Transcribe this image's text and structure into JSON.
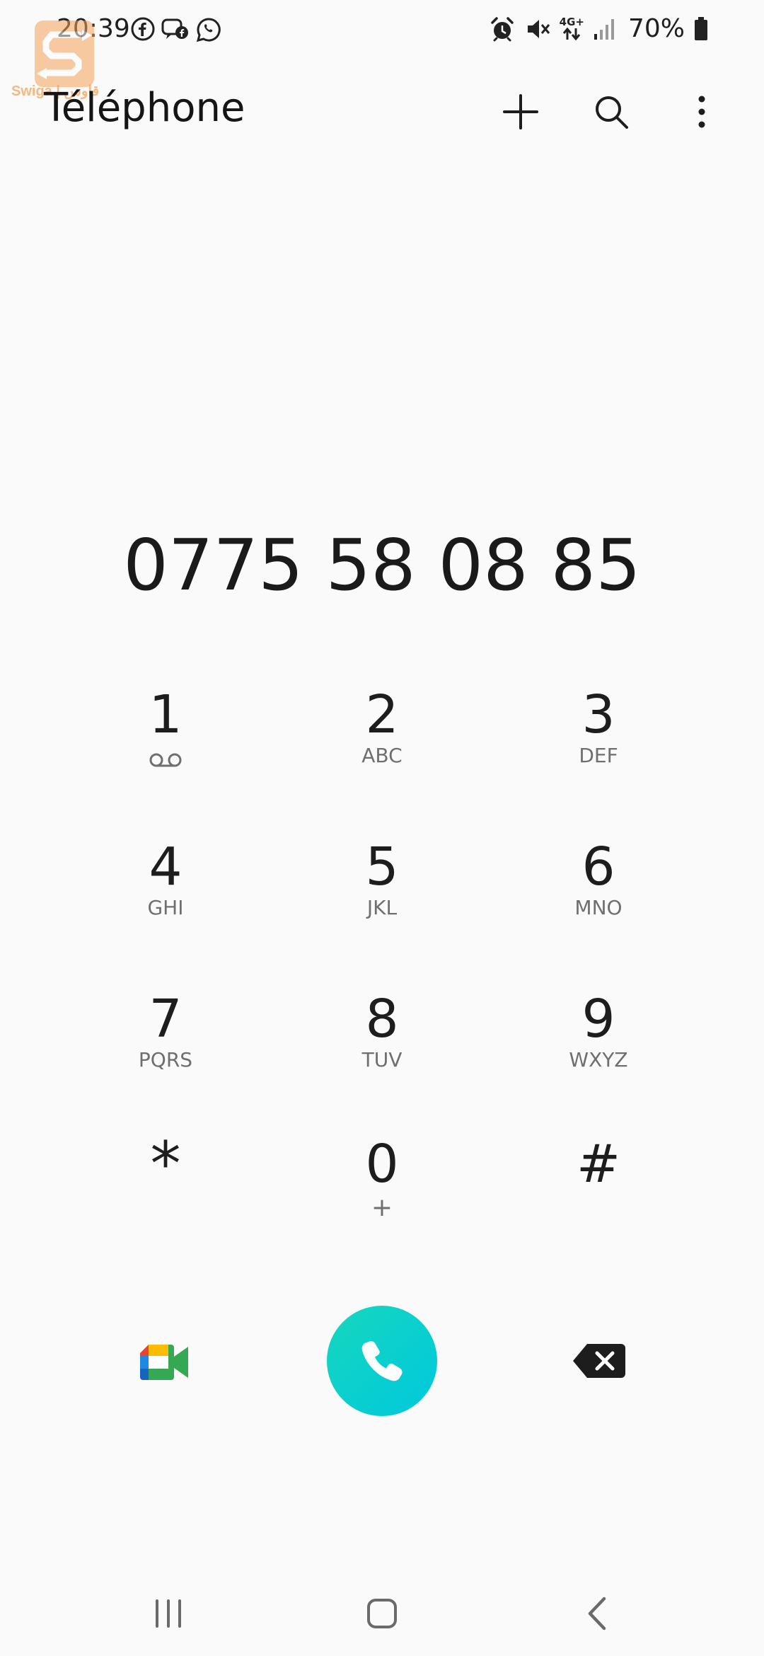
{
  "status_bar": {
    "time": "20:39",
    "battery_percent": "70%",
    "network_label": "4G+",
    "notification_icons": [
      "facebook-icon",
      "messenger-icon",
      "whatsapp-icon"
    ],
    "system_icons": [
      "alarm-icon",
      "mute-icon",
      "4g-data-icon",
      "signal-icon",
      "battery-icon"
    ]
  },
  "watermark": {
    "text": "Swiga | قاوس"
  },
  "header": {
    "title": "Téléphone",
    "actions": [
      "add-icon",
      "search-icon",
      "more-vert-icon"
    ]
  },
  "dialer": {
    "number": "0775 58 08 85",
    "keys": [
      {
        "digit": "1",
        "letters": "",
        "sub_icon": "voicemail-icon"
      },
      {
        "digit": "2",
        "letters": "ABC"
      },
      {
        "digit": "3",
        "letters": "DEF"
      },
      {
        "digit": "4",
        "letters": "GHI"
      },
      {
        "digit": "5",
        "letters": "JKL"
      },
      {
        "digit": "6",
        "letters": "MNO"
      },
      {
        "digit": "7",
        "letters": "PQRS"
      },
      {
        "digit": "8",
        "letters": "TUV"
      },
      {
        "digit": "9",
        "letters": "WXYZ"
      },
      {
        "digit": "*",
        "letters": ""
      },
      {
        "digit": "0",
        "letters": "+"
      },
      {
        "digit": "#",
        "letters": ""
      }
    ]
  },
  "actions": {
    "video_call_icon": "google-meet-icon",
    "call_icon": "phone-icon",
    "backspace_icon": "backspace-icon",
    "call_gradient": [
      "#16d7bd",
      "#00c8de"
    ]
  },
  "nav": {
    "items": [
      "recents-icon",
      "home-icon",
      "back-icon"
    ]
  }
}
